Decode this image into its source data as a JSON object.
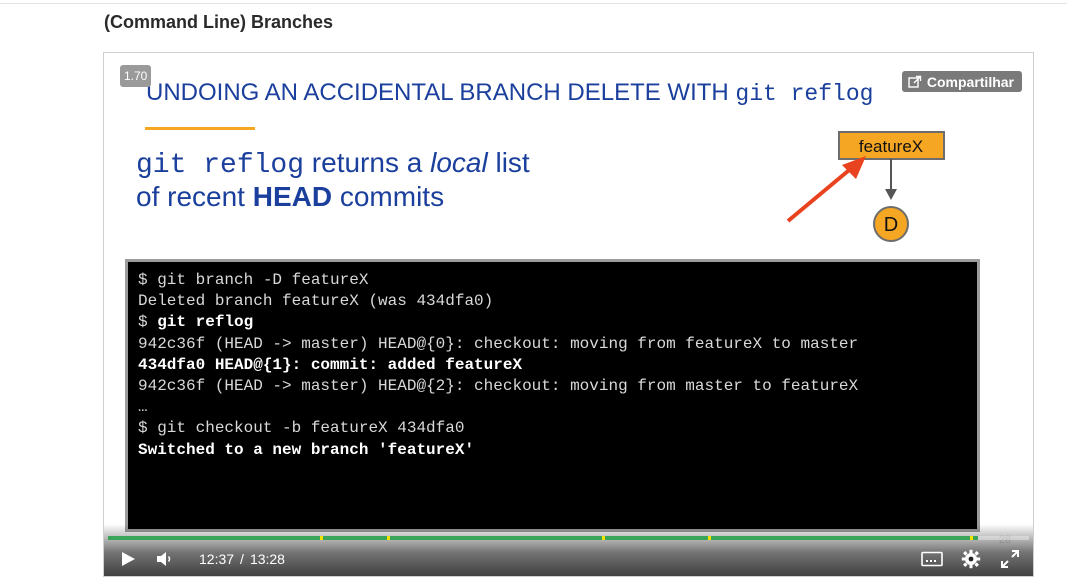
{
  "page": {
    "title": "(Command Line) Branches"
  },
  "player": {
    "speed": "1.70",
    "share_label": "Compartilhar",
    "slide": {
      "heading_text": "UNDOING AN ACCIDENTAL BRANCH DELETE WITH ",
      "heading_code": "git reflog",
      "line1_code": "git reflog",
      "line1_a": " returns a ",
      "line1_em": "local",
      "line1_b": " list",
      "line2_a": "of recent ",
      "line2_strong": "HEAD",
      "line2_b": " commits",
      "diagram": {
        "branch_label": "featureX",
        "commit_label": "D"
      },
      "terminal": {
        "lines": [
          "$ git branch -D featureX",
          "Deleted branch featureX (was 434dfa0)",
          "",
          "$ ",
          "942c36f (HEAD -> master) HEAD@{0}: checkout: moving from featureX to master",
          "434dfa0 HEAD@{1}: commit: added featureX",
          "942c36f (HEAD -> master) HEAD@{2}: checkout: moving from master to featureX",
          "…",
          "",
          "$ git checkout -b featureX 434dfa0",
          "Switched to a new branch 'featureX'"
        ],
        "reflog_cmd": "git reflog"
      },
      "slide_number": "28"
    },
    "controls": {
      "current_time": "12:37",
      "separator": "/",
      "duration": "13:28",
      "progress_fraction": 0.9446
    }
  }
}
